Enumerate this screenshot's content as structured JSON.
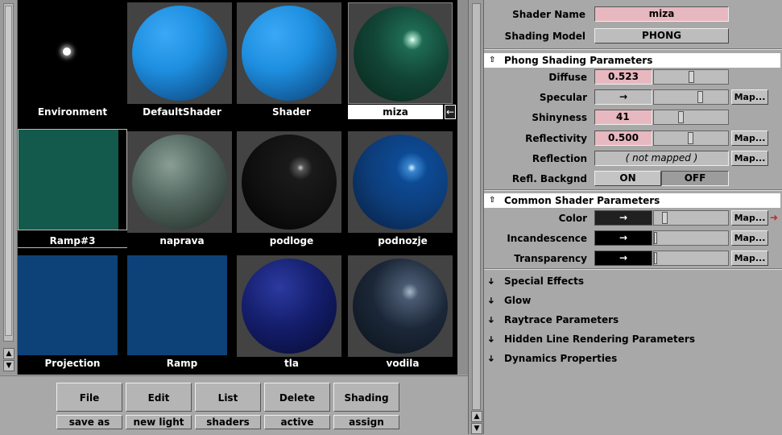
{
  "browser": {
    "cells": [
      {
        "label": "Environment",
        "kind": "environment"
      },
      {
        "label": "DefaultShader",
        "kind": "sphere",
        "color": "#1e8fe0"
      },
      {
        "label": "Shader",
        "kind": "sphere",
        "color": "#1e8fe0"
      },
      {
        "label": "miza",
        "kind": "sphere",
        "color": "#124536",
        "selected": true
      },
      {
        "label": "Ramp#3",
        "kind": "flat",
        "color": "#145a4c"
      },
      {
        "label": "naprava",
        "kind": "sphere",
        "color": "#556a62"
      },
      {
        "label": "podloge",
        "kind": "sphere",
        "color": "#151515"
      },
      {
        "label": "podnozje",
        "kind": "sphere",
        "color": "#0d3d7a"
      },
      {
        "label": "Projection",
        "kind": "flat",
        "color": "#0d4278"
      },
      {
        "label": "Ramp",
        "kind": "flat",
        "color": "#0d4278"
      },
      {
        "label": "tla",
        "kind": "sphere",
        "color": "#141e6c"
      },
      {
        "label": "vodila",
        "kind": "sphere",
        "color": "#1b2738"
      }
    ],
    "edit_arrow": "←"
  },
  "buttons": {
    "top": [
      "File",
      "Edit",
      "List",
      "Delete",
      "Shading"
    ],
    "bottom": [
      "save as",
      "new light",
      "shaders",
      "active",
      "assign"
    ]
  },
  "panel": {
    "shader_name_label": "Shader Name",
    "shader_name": "miza",
    "shading_model_label": "Shading Model",
    "shading_model": "PHONG",
    "phong_section": "Phong Shading Parameters",
    "diffuse_label": "Diffuse",
    "diffuse": "0.523",
    "diffuse_level": 0.523,
    "specular_label": "Specular",
    "specular_arrow": "→",
    "specular_level": 0.65,
    "shinyness_label": "Shinyness",
    "shinyness": "41",
    "shinyness_level": 0.36,
    "reflectivity_label": "Reflectivity",
    "reflectivity": "0.500",
    "reflectivity_level": 0.5,
    "reflection_label": "Reflection",
    "reflection": "( not mapped )",
    "refl_backgnd_label": "Refl. Backgnd",
    "on": "ON",
    "off": "OFF",
    "map_label": "Map...",
    "common_section": "Common Shader Parameters",
    "color_label": "Color",
    "incandescence_label": "Incandescence",
    "transparency_label": "Transparency",
    "color_arrow": "→",
    "collapsed": [
      "Special Effects",
      "Glow",
      "Raytrace Parameters",
      "Hidden Line Rendering Parameters",
      "Dynamics Properties"
    ]
  },
  "colors": {
    "pink": "#e8b8c0",
    "selected_label": "#ffffff",
    "accent_arrow": "#cc2222"
  }
}
